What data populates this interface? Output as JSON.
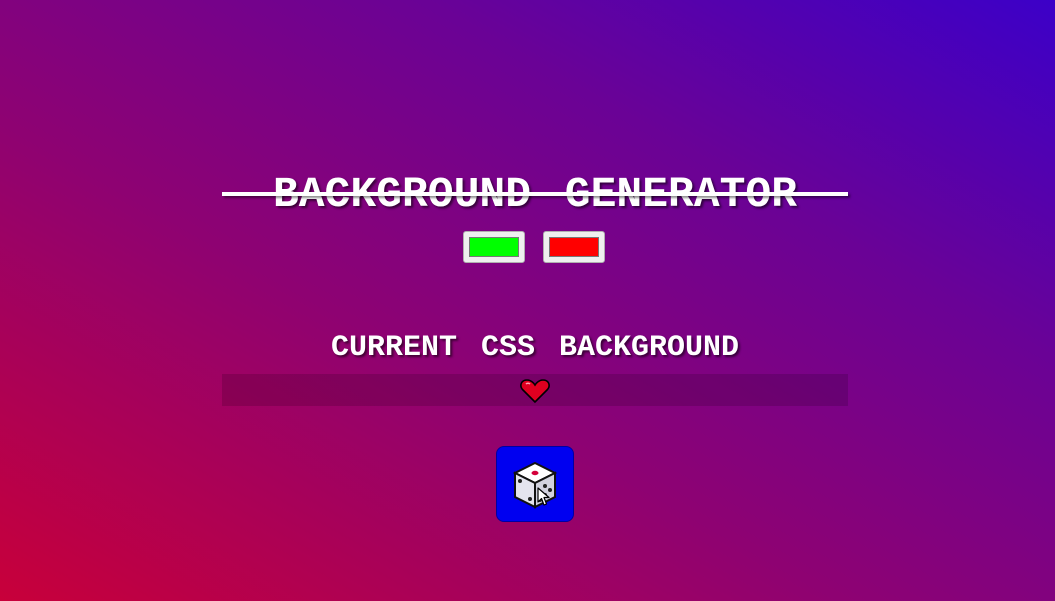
{
  "header": {
    "title": "BACKGROUND GENERATOR"
  },
  "color_inputs": [
    {
      "value": "#00ff00",
      "name": "color1"
    },
    {
      "value": "#ff0000",
      "name": "color2"
    }
  ],
  "subtitle": "CURRENT CSS BACKGROUND",
  "css_output": {
    "text": "",
    "icon": "heart-icon"
  },
  "random_button": {
    "icon": "dice-icon"
  },
  "colors": {
    "accent_button": "#0000f0",
    "heart": "#e00020"
  }
}
